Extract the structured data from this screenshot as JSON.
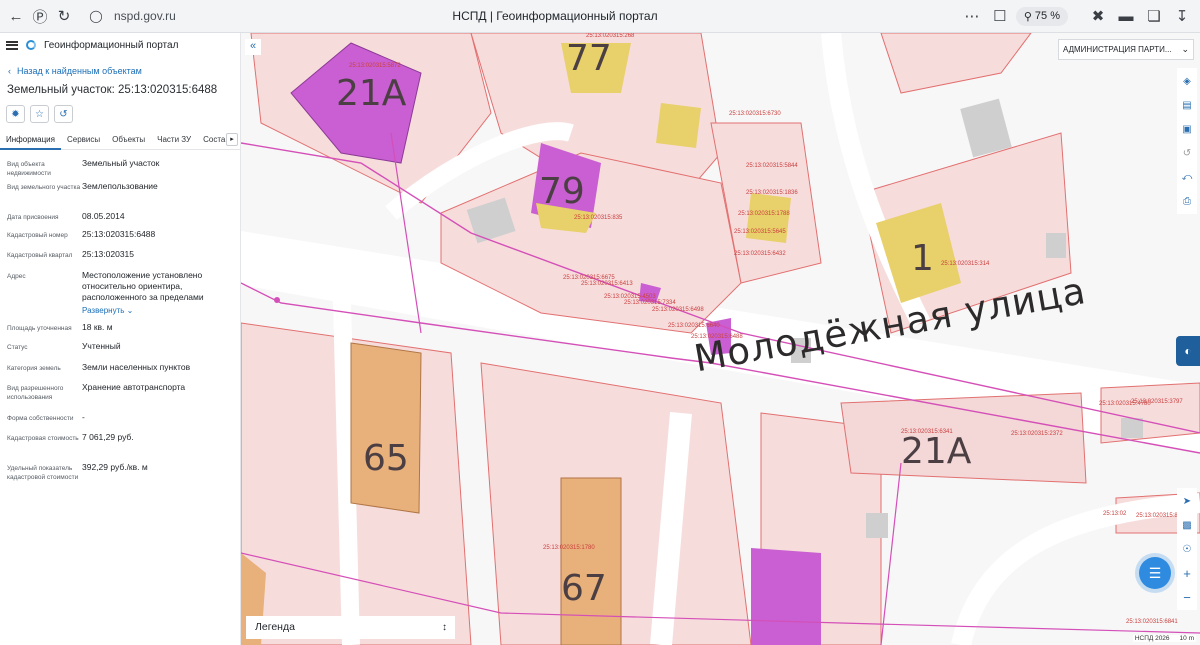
{
  "browser": {
    "url": "nspd.gov.ru",
    "tab_title": "НСПД | Геоинформационный портал",
    "zoom": "75 %"
  },
  "panel": {
    "app_title": "Геоинформационный портал",
    "back_link": "Назад к найденным объектам",
    "title": "Земельный участок: 25:13:020315:6488",
    "tabs": [
      "Информация",
      "Сервисы",
      "Объекты",
      "Части ЗУ",
      "Соста"
    ],
    "attributes": [
      {
        "key": "Вид объекта недвижимости",
        "value": "Земельный участок"
      },
      {
        "key": "Вид земельного участка",
        "value": "Землепользование"
      },
      {
        "key": "Дата присвоения",
        "value": "08.05.2014"
      },
      {
        "key": "Кадастровый номер",
        "value": "25:13:020315:6488"
      },
      {
        "key": "Кадастровый квартал",
        "value": "25:13:020315"
      },
      {
        "key": "Адрес",
        "value": "Местоположение установлено относительно ориентира, расположенного за пределами"
      },
      {
        "key": "Площадь уточненная",
        "value": "18 кв. м"
      },
      {
        "key": "Статус",
        "value": "Учтенный"
      },
      {
        "key": "Категория земель",
        "value": "Земли населенных пунктов"
      },
      {
        "key": "Вид разрешенного использования",
        "value": "Хранение автотранспорта"
      },
      {
        "key": "Форма собственности",
        "value": "-"
      },
      {
        "key": "Кадастровая стоимость",
        "value": "7 061,29 руб."
      },
      {
        "key": "Удельный показатель кадастровой стоимости",
        "value": "392,29 руб./кв. м"
      }
    ],
    "expand_label": "Развернуть"
  },
  "map": {
    "layer_select": "АДМИНИСТРАЦИЯ ПАРТИ...",
    "legend_label": "Легенда",
    "street_name": "Молодёжная улица",
    "house_numbers": [
      "21А",
      "77",
      "79",
      "1",
      "65",
      "67",
      "21А"
    ],
    "cadastral_labels": [
      "25:13:020315:5872",
      "25:13:020315:268",
      "25:13:020315:6730",
      "25:13:020315:5844",
      "25:13:020315:1836",
      "25:13:020315:1788",
      "25:13:020315:5645",
      "25:13:020315:6432",
      "25:13:020315:835",
      "25:13:020315:314",
      "25:13:020315:6675",
      "25:13:020315:6413",
      "25:13:020315:4503",
      "25:13:020315:7334",
      "25:13:020315:6498",
      "25:13:020315:6640",
      "25:13:020315:6488",
      "25:13:020315:6341",
      "25:13:020315:2372",
      "25:13:020315:4780",
      "25:13:020315:3797",
      "25:13:020315:1780",
      "25:13:02",
      "25:13:020315:8275",
      "25:13:020315:6841"
    ],
    "attribution": "НСПД 2026",
    "scale": "10 m"
  },
  "colors": {
    "accent": "#2b6fb0",
    "parcel_fill": "#f6dcdc",
    "parcel_line": "#e06a6a",
    "boundary_line": "#d44fb8",
    "building_magenta": "#c760d2",
    "building_yellow": "#e9d06a",
    "building_orange": "#e8b07a"
  }
}
